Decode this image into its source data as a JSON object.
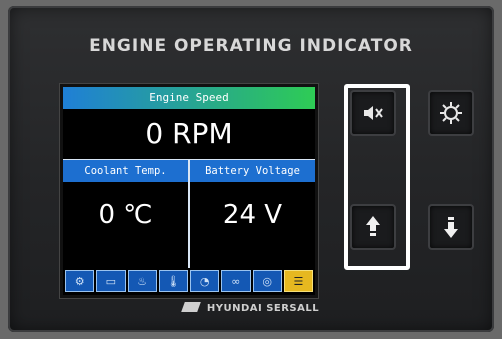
{
  "panel": {
    "title": "ENGINE OPERATING INDICATOR",
    "brand": "HYUNDAI SERSALL"
  },
  "display": {
    "engine_speed": {
      "label": "Engine Speed",
      "value": "0 RPM"
    },
    "coolant_temp": {
      "label": "Coolant Temp.",
      "value": "0 ℃"
    },
    "battery_voltage": {
      "label": "Battery Voltage",
      "value": "24 V"
    },
    "status_icons": [
      {
        "name": "engine-icon",
        "glyph": "⚙",
        "active": false
      },
      {
        "name": "battery-icon",
        "glyph": "▭",
        "active": false
      },
      {
        "name": "oil-can-icon",
        "glyph": "♨",
        "active": false
      },
      {
        "name": "thermometer-icon",
        "glyph": "🌡",
        "active": false
      },
      {
        "name": "oil-drop-icon",
        "glyph": "◔",
        "active": false
      },
      {
        "name": "preheat-coil-icon",
        "glyph": "∞",
        "active": false
      },
      {
        "name": "fuel-icon",
        "glyph": "◎",
        "active": false
      },
      {
        "name": "emergency-icon",
        "glyph": "☰",
        "active": true
      }
    ]
  },
  "buttons": {
    "mute": {
      "icon": "mute-speaker-icon"
    },
    "lamp_test": {
      "icon": "lamp-icon"
    },
    "up": {
      "icon": "up-arrow-icon"
    },
    "down": {
      "icon": "down-arrow-icon"
    }
  },
  "colors": {
    "header_blue": "#1d6fd0",
    "speed_gradient_end": "#2ecc55",
    "active_icon": "#e6b820",
    "highlight_frame": "#ffffff"
  }
}
